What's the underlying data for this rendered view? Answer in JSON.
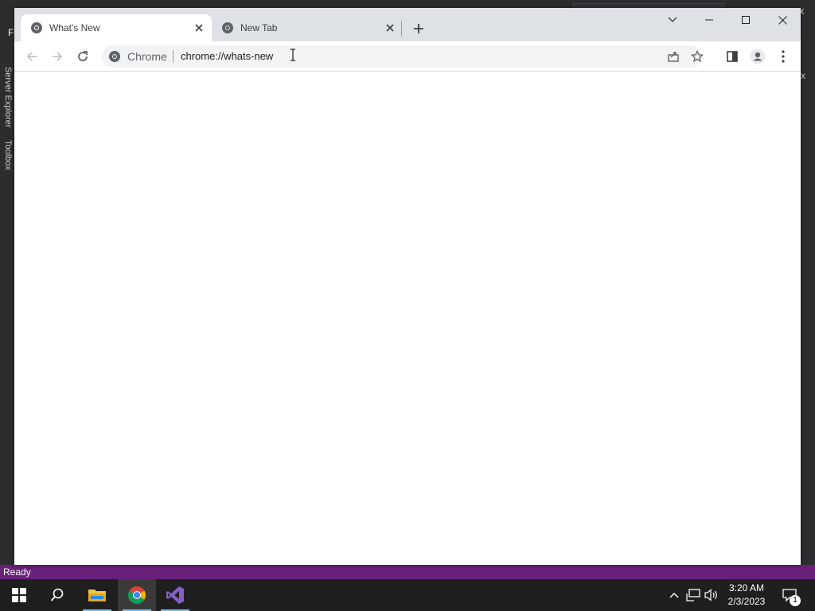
{
  "vs": {
    "menu_letter": "F",
    "right_x": "x",
    "top_x": "x",
    "left_tabs": [
      "Server Explorer",
      "Toolbox"
    ],
    "status_text": "Ready",
    "status_color": "#68217a"
  },
  "chrome": {
    "tabs": [
      {
        "title": "What's New",
        "active": true
      },
      {
        "title": "New Tab",
        "active": false
      }
    ],
    "omnibox": {
      "chip": "Chrome",
      "url": "chrome://whats-new"
    },
    "icons": {
      "back": "arrow-left-icon",
      "forward": "arrow-right-icon",
      "reload": "reload-icon",
      "share": "share-icon",
      "bookmark": "star-icon",
      "side_panel": "side-panel-icon",
      "profile": "profile-icon",
      "menu": "three-dots-icon",
      "tab_search": "chevron-down-icon",
      "minimize": "minimize-icon",
      "maximize": "maximize-icon",
      "close": "close-icon"
    }
  },
  "taskbar": {
    "apps": [
      "start",
      "search",
      "file-explorer",
      "chrome",
      "visual-studio"
    ],
    "clock_time": "3:20 AM",
    "clock_date": "2/3/2023",
    "notification_count": "1"
  }
}
